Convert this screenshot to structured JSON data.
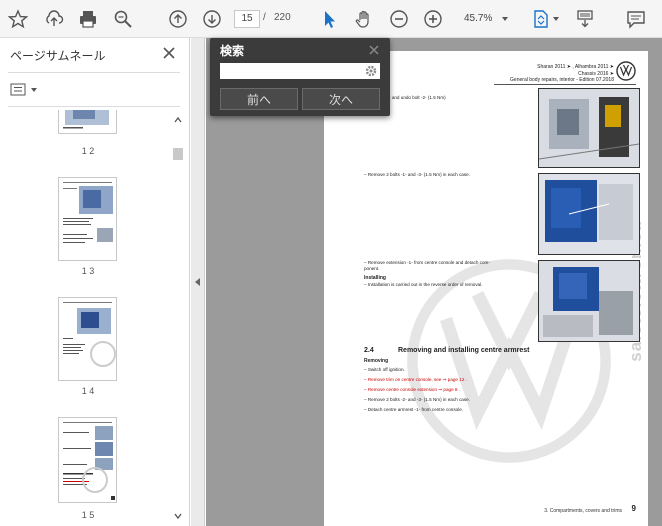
{
  "toolbar": {
    "icons": [
      "bookmark-star-icon",
      "upload-icon",
      "print-icon",
      "zoom-search-icon",
      "prev-page-icon",
      "next-page-icon",
      "select-cursor-icon",
      "hand-tool-icon",
      "zoom-out-icon",
      "zoom-in-icon",
      "page-fit-icon",
      "read-mode-icon",
      "comment-icon"
    ],
    "current_page": "15",
    "page_separator": "/",
    "total_pages": "220",
    "zoom": "45.7%",
    "accent_color": "#1a73c9"
  },
  "sidebar": {
    "title": "ページサムネール",
    "thumbnails": [
      {
        "label": "1 2"
      },
      {
        "label": "1 3"
      },
      {
        "label": "1 4"
      },
      {
        "label": "1 5"
      }
    ]
  },
  "search": {
    "title": "検索",
    "value": "",
    "prev_label": "前へ",
    "next_label": "次へ"
  },
  "document": {
    "header": {
      "line1": "Sharan 2011 ➤ , Alhambra 2011 ➤",
      "line2": "Chassis 2016 ➤",
      "line3": "General body repairs, interior - Edition 07.2018"
    },
    "lines": {
      "l1": "lining mat -1- and undo bolt -2- (1.5 Nm)",
      "l2": "–  Remove 2 bolts -1- and -3- (1.5 Nm) in each case.",
      "l3": "–  Remove extension -1- from centre console and detach com-",
      "l3b": "   ponent.",
      "l4": "Installing",
      "l5": "–  Installation is carried out in the reverse order of removal."
    },
    "section": {
      "number": "2.4",
      "title": "Removing and installing centre armrest",
      "removing": "Removing",
      "steps": [
        "–  Switch off ignition.",
        "–  Remove trim on centre console, see ⇒ page 12 .",
        "–  Remove centre console extension ⇒ page 8 .",
        "–  Remove 2 bolts -2- and -3- (1.5 Nm) in each case.",
        "–  Detach centre armrest -1- from centre console."
      ]
    },
    "footer": "3. Compartments, covers and trims",
    "page_number": "9",
    "watermark": "saletelettronica"
  }
}
